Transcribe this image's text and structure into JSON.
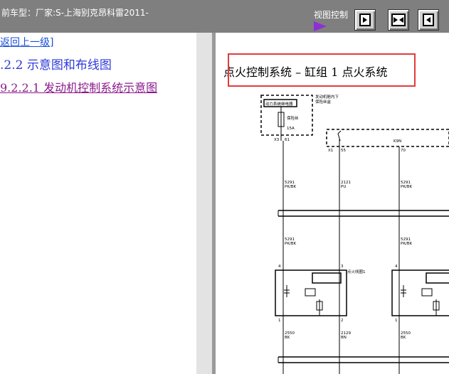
{
  "app": {
    "title": "前车型：厂家:S-上海别克昂科雷2011-",
    "view_control_label": "视图控制"
  },
  "toolbar": {
    "buttons": [
      {
        "icon": "move-right-icon"
      },
      {
        "icon": "split-both-icon"
      },
      {
        "icon": "move-left-icon"
      }
    ]
  },
  "nav": {
    "back_link": "返回上一级]",
    "section_heading": ".2.2 示意图和布线图",
    "sub_link": "9.2.2.1 发动机控制系统示意图"
  },
  "diagram": {
    "title": "点火控制系统 – 缸组 1 点火系统",
    "labels": {
      "relay": "动力系统继电器",
      "hot_note_1": "发动机舱内下",
      "hot_note_2": "保险丝盒",
      "fuse_1": "保险丝",
      "fuse_2": "15A",
      "conn_x3": "X3",
      "pin_61": "61",
      "conn_x1": "X1",
      "pin_55": "55",
      "pin_k9n": "K9N",
      "pin_70": "70",
      "w1": "5291",
      "w1c": "PK/BK",
      "w2": "2121",
      "w2c": "PU",
      "w3": "5291",
      "w3c": "PK/BK",
      "coil_label": "点火线圈1",
      "pin4": "4",
      "pin3": "3",
      "pin1": "1",
      "pin2": "2",
      "g1": "2550",
      "g1c": "BK",
      "g2": "2129",
      "g2c": "BN",
      "g3": "2550",
      "g3c": "BK"
    }
  }
}
